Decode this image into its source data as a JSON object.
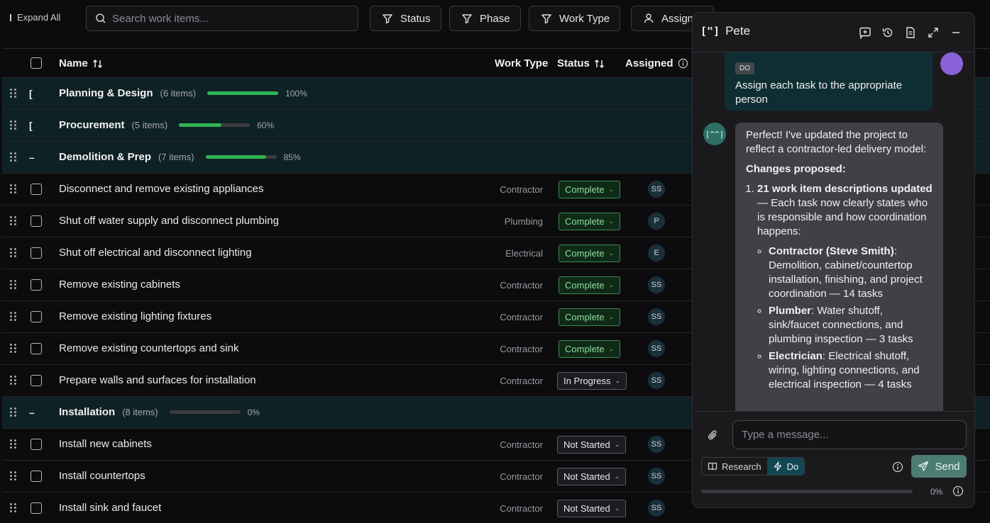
{
  "toolbar": {
    "expand_label": "Expand All",
    "search_placeholder": "Search work items...",
    "filters": [
      "Status",
      "Phase",
      "Work Type",
      "Assign"
    ]
  },
  "table": {
    "headers": {
      "name": "Name",
      "work_type": "Work Type",
      "status": "Status",
      "assigned": "Assigned"
    },
    "rows": [
      {
        "kind": "group",
        "name": "Planning & Design",
        "count": "(6 items)",
        "progress": 100,
        "pct": "100%",
        "expanded": false
      },
      {
        "kind": "group",
        "name": "Procurement",
        "count": "(5 items)",
        "progress": 60,
        "pct": "60%",
        "expanded": false
      },
      {
        "kind": "group",
        "name": "Demolition & Prep",
        "count": "(7 items)",
        "progress": 85,
        "pct": "85%",
        "expanded": true
      },
      {
        "kind": "task",
        "name": "Disconnect and remove existing appliances",
        "work_type": "Contractor",
        "status": "Complete",
        "status_kind": "complete",
        "assignee": "SS"
      },
      {
        "kind": "task",
        "name": "Shut off water supply and disconnect plumbing",
        "work_type": "Plumbing",
        "status": "Complete",
        "status_kind": "complete",
        "assignee": "P"
      },
      {
        "kind": "task",
        "name": "Shut off electrical and disconnect lighting",
        "work_type": "Electrical",
        "status": "Complete",
        "status_kind": "complete",
        "assignee": "E"
      },
      {
        "kind": "task",
        "name": "Remove existing cabinets",
        "work_type": "Contractor",
        "status": "Complete",
        "status_kind": "complete",
        "assignee": "SS"
      },
      {
        "kind": "task",
        "name": "Remove existing lighting fixtures",
        "work_type": "Contractor",
        "status": "Complete",
        "status_kind": "complete",
        "assignee": "SS"
      },
      {
        "kind": "task",
        "name": "Remove existing countertops and sink",
        "work_type": "Contractor",
        "status": "Complete",
        "status_kind": "complete",
        "assignee": "SS"
      },
      {
        "kind": "task",
        "name": "Prepare walls and surfaces for installation",
        "work_type": "Contractor",
        "status": "In Progress",
        "status_kind": "progress",
        "assignee": "SS"
      },
      {
        "kind": "group",
        "name": "Installation",
        "count": "(8 items)",
        "progress": 0,
        "pct": "0%",
        "expanded": true
      },
      {
        "kind": "task",
        "name": "Install new cabinets",
        "work_type": "Contractor",
        "status": "Not Started",
        "status_kind": "notstarted",
        "assignee": "SS"
      },
      {
        "kind": "task",
        "name": "Install countertops",
        "work_type": "Contractor",
        "status": "Not Started",
        "status_kind": "notstarted",
        "assignee": "SS"
      },
      {
        "kind": "task",
        "name": "Install sink and faucet",
        "work_type": "Contractor",
        "status": "Not Started",
        "status_kind": "notstarted",
        "assignee": "SS"
      }
    ]
  },
  "chat": {
    "title": "Pete",
    "logo": "[\"]",
    "user_message": {
      "tag": "DO",
      "text": "Assign each task to the appropriate person"
    },
    "assistant_avatar": "[^^]",
    "assistant_message": {
      "intro": "Perfect! I've updated the project to reflect a contractor-led delivery model:",
      "changes_heading": "Changes proposed:",
      "item1_bold": "21 work item descriptions updated",
      "item1_rest": " — Each task now clearly states who is responsible and how coordination happens:",
      "bullets": [
        {
          "bold": "Contractor (Steve Smith)",
          "rest": ": Demolition, cabinet/countertop installation, finishing, and project coordination — 14 tasks"
        },
        {
          "bold": "Plumber",
          "rest": ": Water shutoff, sink/faucet connections, and plumbing inspection — 3 tasks"
        },
        {
          "bold": "Electrician",
          "rest": ": Electrical shutoff, wiring, lighting connections, and electrical inspection — 4 tasks"
        }
      ]
    },
    "input_placeholder": "Type a message...",
    "modes": [
      "Research",
      "Do"
    ],
    "active_mode": "Do",
    "send_label": "Send",
    "context_pct": "0%"
  },
  "colors": {
    "accent_green": "#2fb552",
    "group_bg": "#0e2125",
    "complete_text": "#8fdc9f",
    "send_bg": "#4d7d72"
  }
}
